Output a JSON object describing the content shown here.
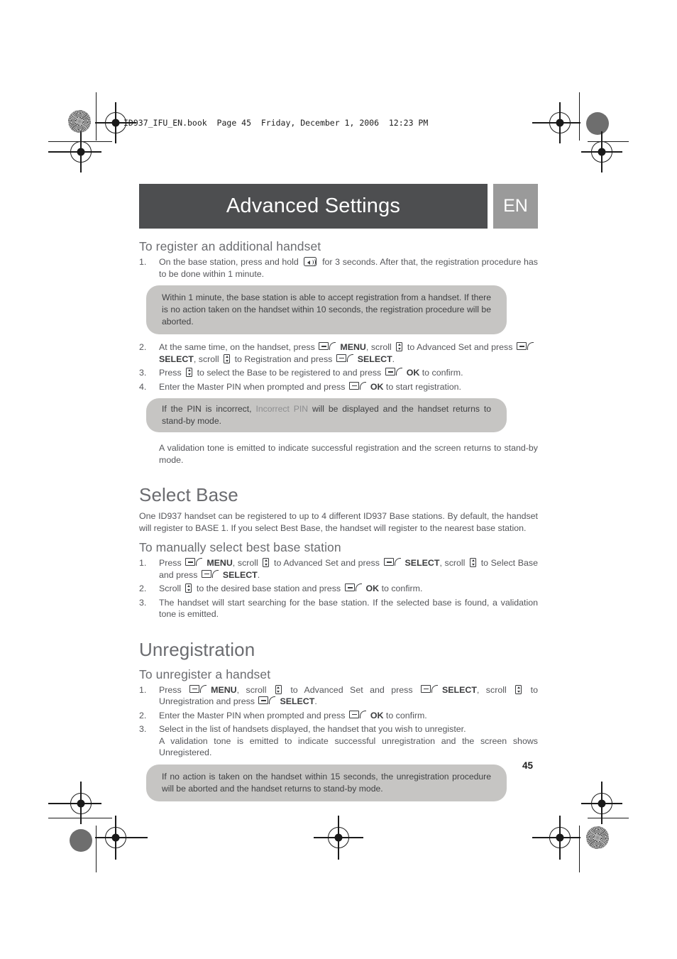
{
  "print_header": "ID937_IFU_EN.book  Page 45  Friday, December 1, 2006  12:23 PM",
  "page_number": "45",
  "colors": {
    "title_bar": "#4d4e50",
    "lang_badge": "#9a9a9a",
    "note_background": "#c6c5c3",
    "body_text": "#55565a",
    "heading_text": "#6b6c70"
  },
  "header": {
    "title": "Advanced Settings",
    "language_badge": "EN"
  },
  "sections": [
    {
      "id": "register-additional-handset",
      "heading": "To register an additional handset",
      "steps": [
        {
          "parts": [
            {
              "t": "text",
              "v": "On the base station, press and hold "
            },
            {
              "t": "icon",
              "v": "paging-key-icon"
            },
            {
              "t": "text",
              "v": " for 3 seconds. After that, the registration procedure has to be done within 1 minute."
            }
          ]
        },
        {
          "parts": [
            {
              "t": "text",
              "v": "At the same time, on the handset, press "
            },
            {
              "t": "icon",
              "v": "soft-key-icon"
            },
            {
              "t": "bold",
              "v": "MENU"
            },
            {
              "t": "text",
              "v": ", scroll "
            },
            {
              "t": "icon",
              "v": "scroll-key-icon"
            },
            {
              "t": "text",
              "v": " to Advanced Set and press "
            },
            {
              "t": "icon",
              "v": "soft-key-icon"
            },
            {
              "t": "bold",
              "v": "SELECT"
            },
            {
              "t": "text",
              "v": ", scroll "
            },
            {
              "t": "icon",
              "v": "scroll-key-icon"
            },
            {
              "t": "text",
              "v": " to Registration and press "
            },
            {
              "t": "icon",
              "v": "soft-key-icon"
            },
            {
              "t": "bold",
              "v": "SELECT"
            },
            {
              "t": "text",
              "v": "."
            }
          ]
        },
        {
          "parts": [
            {
              "t": "text",
              "v": "Press "
            },
            {
              "t": "icon",
              "v": "scroll-key-icon"
            },
            {
              "t": "text",
              "v": " to select the Base to be registered to and press "
            },
            {
              "t": "icon",
              "v": "soft-key-icon"
            },
            {
              "t": "bold",
              "v": "OK"
            },
            {
              "t": "text",
              "v": " to confirm."
            }
          ]
        },
        {
          "parts": [
            {
              "t": "text",
              "v": "Enter the Master PIN when prompted and press "
            },
            {
              "t": "icon",
              "v": "soft-key-icon"
            },
            {
              "t": "bold",
              "v": "OK"
            },
            {
              "t": "text",
              "v": " to start registration."
            }
          ]
        }
      ],
      "note_after_step_1": "Within 1 minute, the base station is able to accept registration from a handset. If there is no action taken on the handset within 10 seconds, the registration procedure will be aborted.",
      "note_after_step_4": {
        "parts": [
          {
            "t": "text",
            "v": "If the PIN is incorrect, "
          },
          {
            "t": "light",
            "v": "Incorrect PIN"
          },
          {
            "t": "text",
            "v": " will be displayed and the handset returns to stand-by mode."
          }
        ]
      },
      "closing": "A validation tone is emitted to indicate successful registration and the screen returns to stand-by mode."
    },
    {
      "id": "select-base",
      "heading": "Select Base",
      "intro": "One ID937 handset can be registered to up to 4 different ID937 Base stations. By default, the handset will register to BASE 1. If you select Best Base, the handset will register to the nearest base station.",
      "subheading": "To manually select best base station",
      "steps": [
        {
          "parts": [
            {
              "t": "text",
              "v": "Press "
            },
            {
              "t": "icon",
              "v": "soft-key-icon"
            },
            {
              "t": "bold",
              "v": "MENU"
            },
            {
              "t": "text",
              "v": ", scroll "
            },
            {
              "t": "icon",
              "v": "scroll-key-icon"
            },
            {
              "t": "text",
              "v": " to Advanced Set and press "
            },
            {
              "t": "icon",
              "v": "soft-key-icon"
            },
            {
              "t": "bold",
              "v": "SELECT"
            },
            {
              "t": "text",
              "v": ", scroll "
            },
            {
              "t": "icon",
              "v": "scroll-key-icon"
            },
            {
              "t": "text",
              "v": " to Select Base and press "
            },
            {
              "t": "icon",
              "v": "soft-key-icon"
            },
            {
              "t": "bold",
              "v": "SELECT"
            },
            {
              "t": "text",
              "v": "."
            }
          ]
        },
        {
          "parts": [
            {
              "t": "text",
              "v": "Scroll "
            },
            {
              "t": "icon",
              "v": "scroll-key-icon"
            },
            {
              "t": "text",
              "v": " to the desired base station and press "
            },
            {
              "t": "icon",
              "v": "soft-key-icon"
            },
            {
              "t": "bold",
              "v": "OK"
            },
            {
              "t": "text",
              "v": " to confirm."
            }
          ]
        },
        {
          "parts": [
            {
              "t": "text",
              "v": "The handset will start searching for the base station. If the selected base is found, a validation tone is emitted."
            }
          ]
        }
      ]
    },
    {
      "id": "unregistration",
      "heading": "Unregistration",
      "subheading": "To unregister a handset",
      "steps": [
        {
          "parts": [
            {
              "t": "text",
              "v": "Press "
            },
            {
              "t": "icon",
              "v": "soft-key-icon"
            },
            {
              "t": "bold",
              "v": "MENU"
            },
            {
              "t": "text",
              "v": ", scroll "
            },
            {
              "t": "icon",
              "v": "scroll-key-icon"
            },
            {
              "t": "text",
              "v": " to Advanced Set and press "
            },
            {
              "t": "icon",
              "v": "soft-key-icon"
            },
            {
              "t": "bold",
              "v": "SELECT"
            },
            {
              "t": "text",
              "v": ", scroll "
            },
            {
              "t": "icon",
              "v": "scroll-key-icon"
            },
            {
              "t": "text",
              "v": " to Unregistration and press "
            },
            {
              "t": "icon",
              "v": "soft-key-icon"
            },
            {
              "t": "bold",
              "v": "SELECT"
            },
            {
              "t": "text",
              "v": "."
            }
          ]
        },
        {
          "parts": [
            {
              "t": "text",
              "v": "Enter the Master PIN when prompted and press "
            },
            {
              "t": "icon",
              "v": "soft-key-icon"
            },
            {
              "t": "bold",
              "v": "OK"
            },
            {
              "t": "text",
              "v": " to confirm."
            }
          ]
        },
        {
          "parts": [
            {
              "t": "text",
              "v": "Select in the list of handsets displayed, the handset that you wish to unregister."
            },
            {
              "t": "break",
              "v": ""
            },
            {
              "t": "text",
              "v": "A validation tone is emitted to indicate successful unregistration and the screen shows Unregistered."
            }
          ]
        }
      ],
      "note": "If no action is taken on the handset within 15 seconds, the unregistration procedure will be aborted and the handset returns to stand-by mode."
    }
  ]
}
